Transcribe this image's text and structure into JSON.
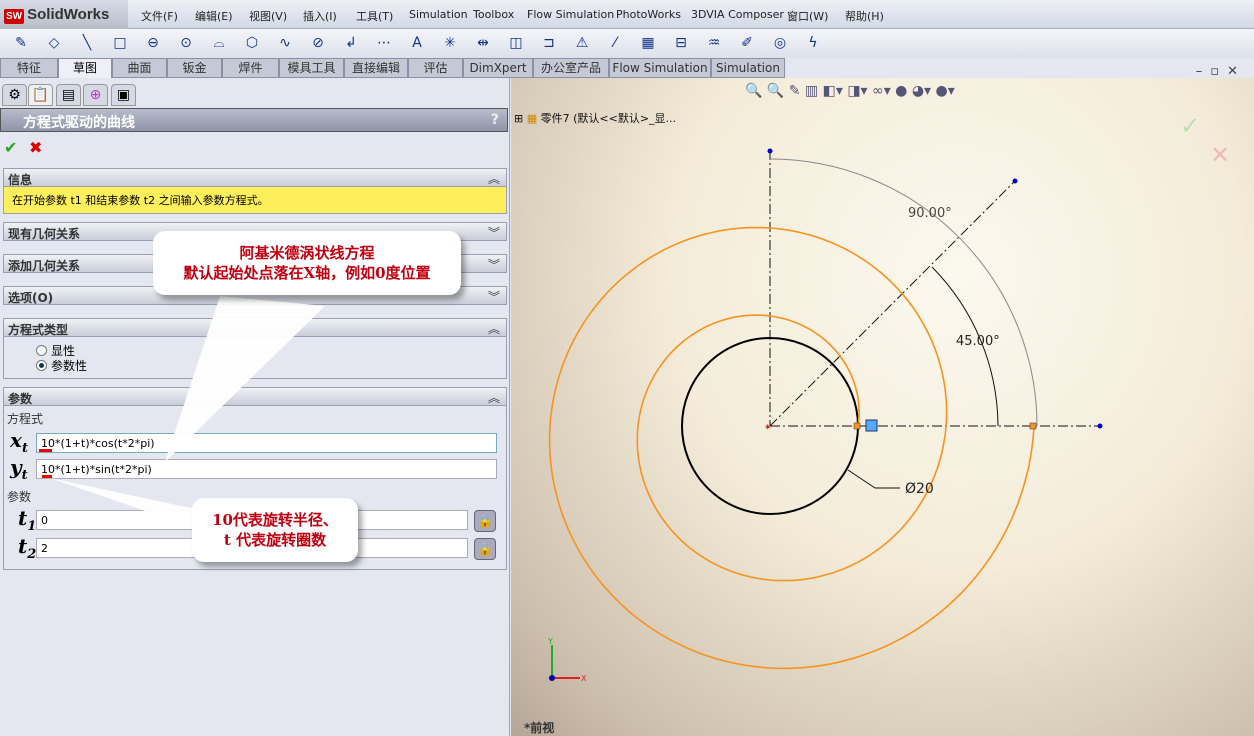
{
  "app": {
    "logo_badge": "SW",
    "logo_text": "SolidWorks"
  },
  "menu": [
    "文件(F)",
    "编辑(E)",
    "视图(V)",
    "插入(I)",
    "工具(T)",
    "Simulation",
    "Toolbox",
    "Flow Simulation",
    "PhotoWorks",
    "3DVIA Composer",
    "窗口(W)",
    "帮助(H)"
  ],
  "tabs": [
    "特征",
    "草图",
    "曲面",
    "钣金",
    "焊件",
    "模具工具",
    "直接编辑",
    "评估",
    "DimXpert",
    "办公室产品",
    "Flow Simulation",
    "Simulation"
  ],
  "active_tab": "草图",
  "panel": {
    "title": "方程式驱动的曲线",
    "help": "?",
    "ok_icon": "check-icon",
    "cancel_icon": "close-icon",
    "info_title": "信息",
    "info_text": "在开始参数 t1 和结束参数 t2 之间输入参数方程式。",
    "existing_relations": "现有几何关系",
    "add_relations": "添加几何关系",
    "options": "选项(O)",
    "eq_type_title": "方程式类型",
    "eq_types": [
      "显性",
      "参数性"
    ],
    "eq_type_selected": "参数性",
    "params_title": "参数",
    "equation_label": "方程式",
    "xt_label": "x",
    "xt_sub": "t",
    "xt": "10*(1+t)*cos(t*2*pi)",
    "yt_label": "y",
    "yt_sub": "t",
    "yt": "10*(1+t)*sin(t*2*pi)",
    "param_label": "参数",
    "t1_label": "t",
    "t1_sub": "1",
    "t1": "0",
    "t2_label": "t",
    "t2_sub": "2",
    "t2": "2"
  },
  "callouts": {
    "top": [
      "阿基米德涡状线方程",
      "默认起始处点落在X轴，例如0度位置"
    ],
    "bottom": [
      "10代表旋转半径、",
      "t  代表旋转圈数"
    ]
  },
  "view": {
    "tree_item": "零件7  (默认<<默认>_显...",
    "dim_angle_outer": "90.00°",
    "dim_angle_inner": "45.00°",
    "dim_diameter": "Ø20",
    "axis_x": "X",
    "axis_y": "Y",
    "view_name": "*前视",
    "spiral_color": "#f7931e",
    "circle_color": "#000000"
  }
}
